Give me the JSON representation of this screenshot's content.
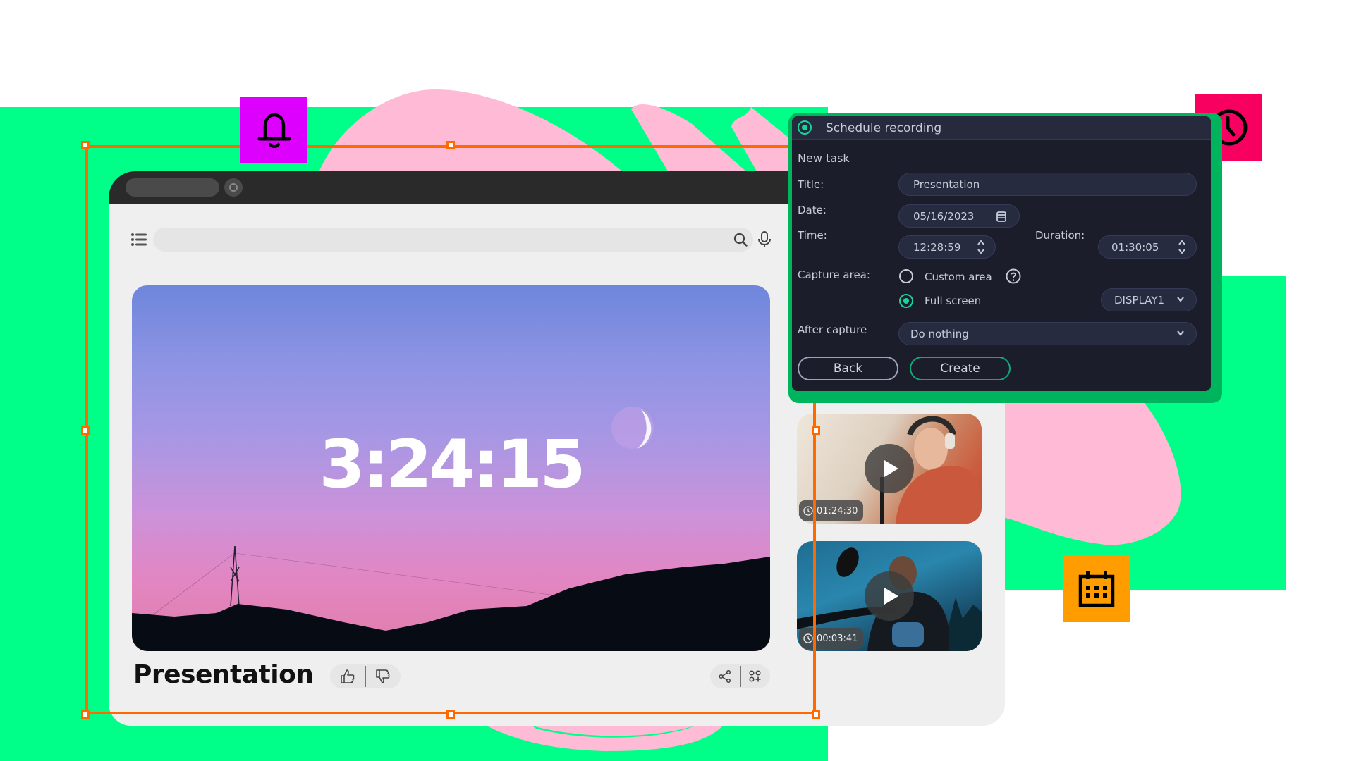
{
  "browser": {
    "search": {
      "placeholder": ""
    },
    "video": {
      "timer": "3:24:15",
      "title": "Presentation"
    },
    "actions": {
      "like": "like-icon",
      "dislike": "dislike-icon",
      "share": "share-icon",
      "add_to_collection": "add-to-collection-icon"
    },
    "thumbnails": [
      {
        "duration": "01:24:30"
      },
      {
        "duration": "00:03:41"
      }
    ]
  },
  "decor_icons": {
    "bell": "bell-icon",
    "clock": "clock-icon",
    "calendar": "calendar-icon"
  },
  "dialog": {
    "title": "Schedule recording",
    "section": "New task",
    "fields": {
      "title_label": "Title:",
      "title_value": "Presentation",
      "date_label": "Date:",
      "date_value": "05/16/2023",
      "time_label": "Time:",
      "time_value": "12:28:59",
      "duration_label": "Duration:",
      "duration_value": "01:30:05",
      "capture_label": "Capture area:",
      "capture_options": [
        {
          "label": "Custom area",
          "selected": false
        },
        {
          "label": "Full screen",
          "selected": true
        }
      ],
      "display_value": "DISPLAY1",
      "after_label": "After capture",
      "after_value": "Do nothing"
    },
    "buttons": {
      "back": "Back",
      "create": "Create"
    }
  },
  "colors": {
    "green": "#00ff88",
    "pink": "#ffbad6",
    "frame_orange": "#ff6a00",
    "bell_bg": "#dd00ff",
    "clock_bg": "#f7005f",
    "calendar_bg": "#ff9d00",
    "dialog_bg": "#1b1d2a",
    "accent_teal": "#18d39a"
  }
}
